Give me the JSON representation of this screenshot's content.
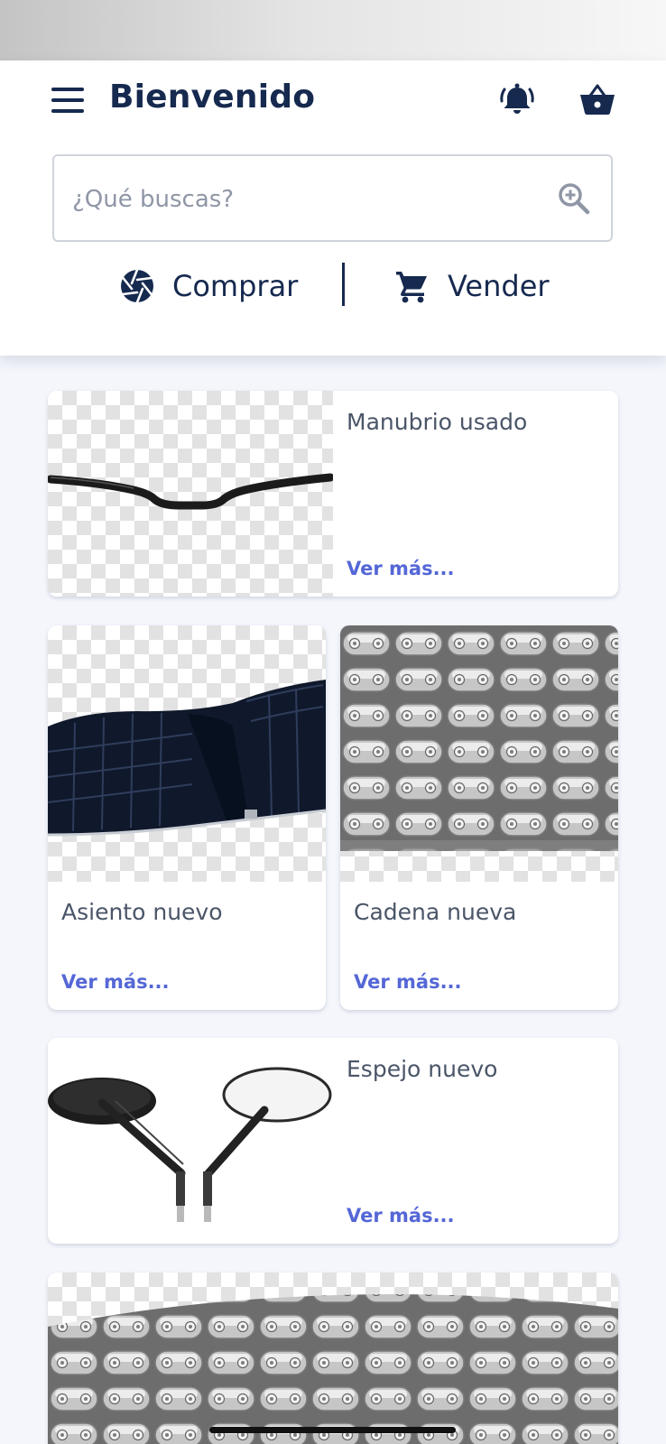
{
  "header": {
    "title": "Bienvenido",
    "search": {
      "placeholder": "¿Qué buscas?",
      "value": ""
    },
    "actions": {
      "buy_label": "Comprar",
      "sell_label": "Vender"
    },
    "icons": {
      "menu": "menu-icon",
      "notifications": "bell-ringing-icon",
      "cart": "basket-icon",
      "search": "zoom-in-icon",
      "buy": "aperture-icon",
      "sell": "shopping-cart-icon"
    },
    "colors": {
      "primary": "#16294f",
      "link": "#5567d6",
      "background": "#f4f6fc"
    }
  },
  "products": [
    {
      "title": "Manubrio usado",
      "link_label": "Ver más..."
    },
    {
      "title": "Asiento nuevo",
      "link_label": "Ver más..."
    },
    {
      "title": "Cadena nueva",
      "link_label": "Ver más..."
    },
    {
      "title": "Espejo nuevo",
      "link_label": "Ver más..."
    }
  ]
}
